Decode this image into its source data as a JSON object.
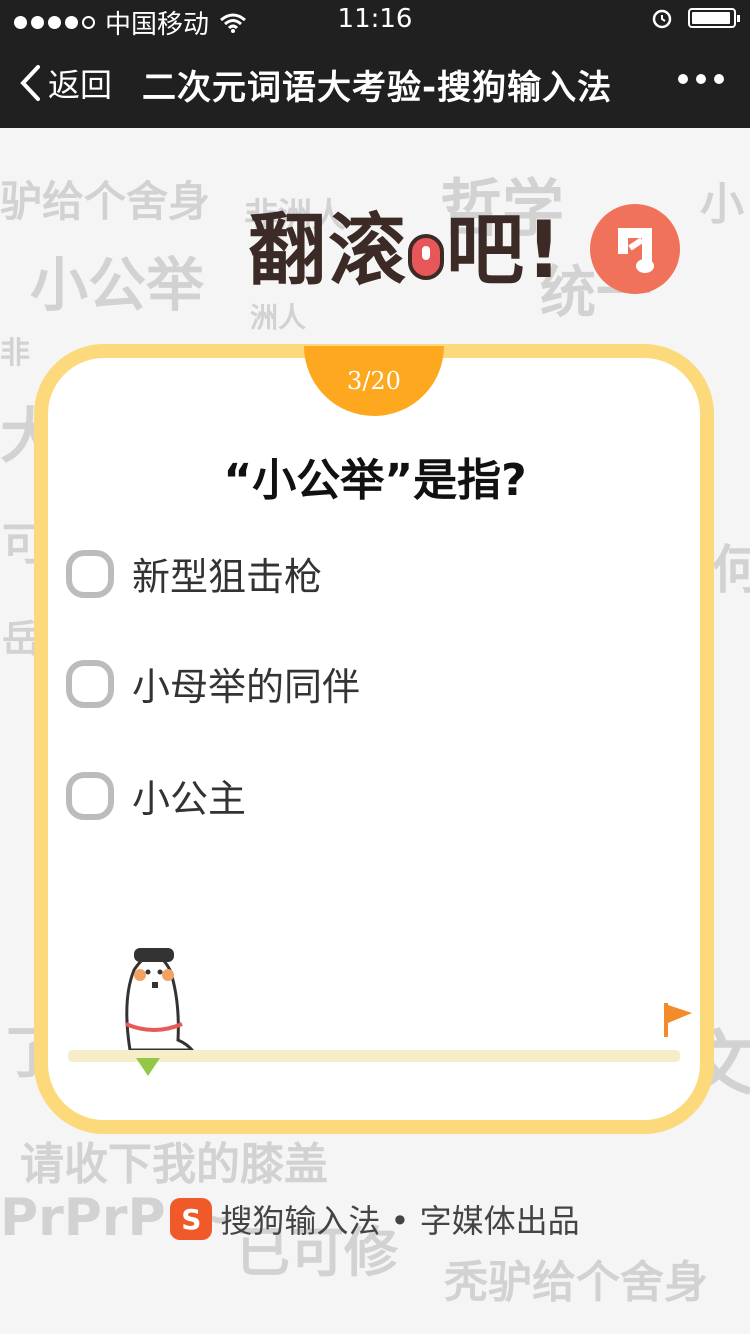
{
  "status_bar": {
    "carrier": "中国移动",
    "time": "11:16",
    "signal_dots_filled": 4,
    "signal_dots_total": 5,
    "icons": [
      "signal-icon",
      "wifi-icon",
      "alarm-icon",
      "battery-icon"
    ]
  },
  "nav": {
    "back_label": "返回",
    "title": "二次元词语大考验-搜狗输入法"
  },
  "game": {
    "logo_chars": [
      "翻",
      "滚",
      "吧",
      "!"
    ],
    "progress": "3/20",
    "question": "“小公举”是指?",
    "options": [
      {
        "label": "新型狙击枪"
      },
      {
        "label": "小母举的同伴"
      },
      {
        "label": "小公主"
      }
    ]
  },
  "footer": {
    "brand_logo_letter": "S",
    "text": "搜狗输入法 • 字媒体出品"
  },
  "background_words": [
    "驴给个舍身",
    "非洲人",
    "哲学",
    "小公举",
    "统一",
    "非",
    "大",
    "可",
    "何",
    "岳",
    "请收下我的膝盖",
    "PrPrPr~",
    "已可修",
    "秃驴给个舍身",
    "小",
    "洲人",
    "了",
    "文"
  ],
  "colors": {
    "nav_bg": "#202020",
    "card_border": "#fcd97a",
    "badge": "#fda81f",
    "music_button": "#f0725a",
    "marker": "#93c847",
    "flag": "#f38b2a",
    "sogou_orange": "#f05a2a"
  }
}
